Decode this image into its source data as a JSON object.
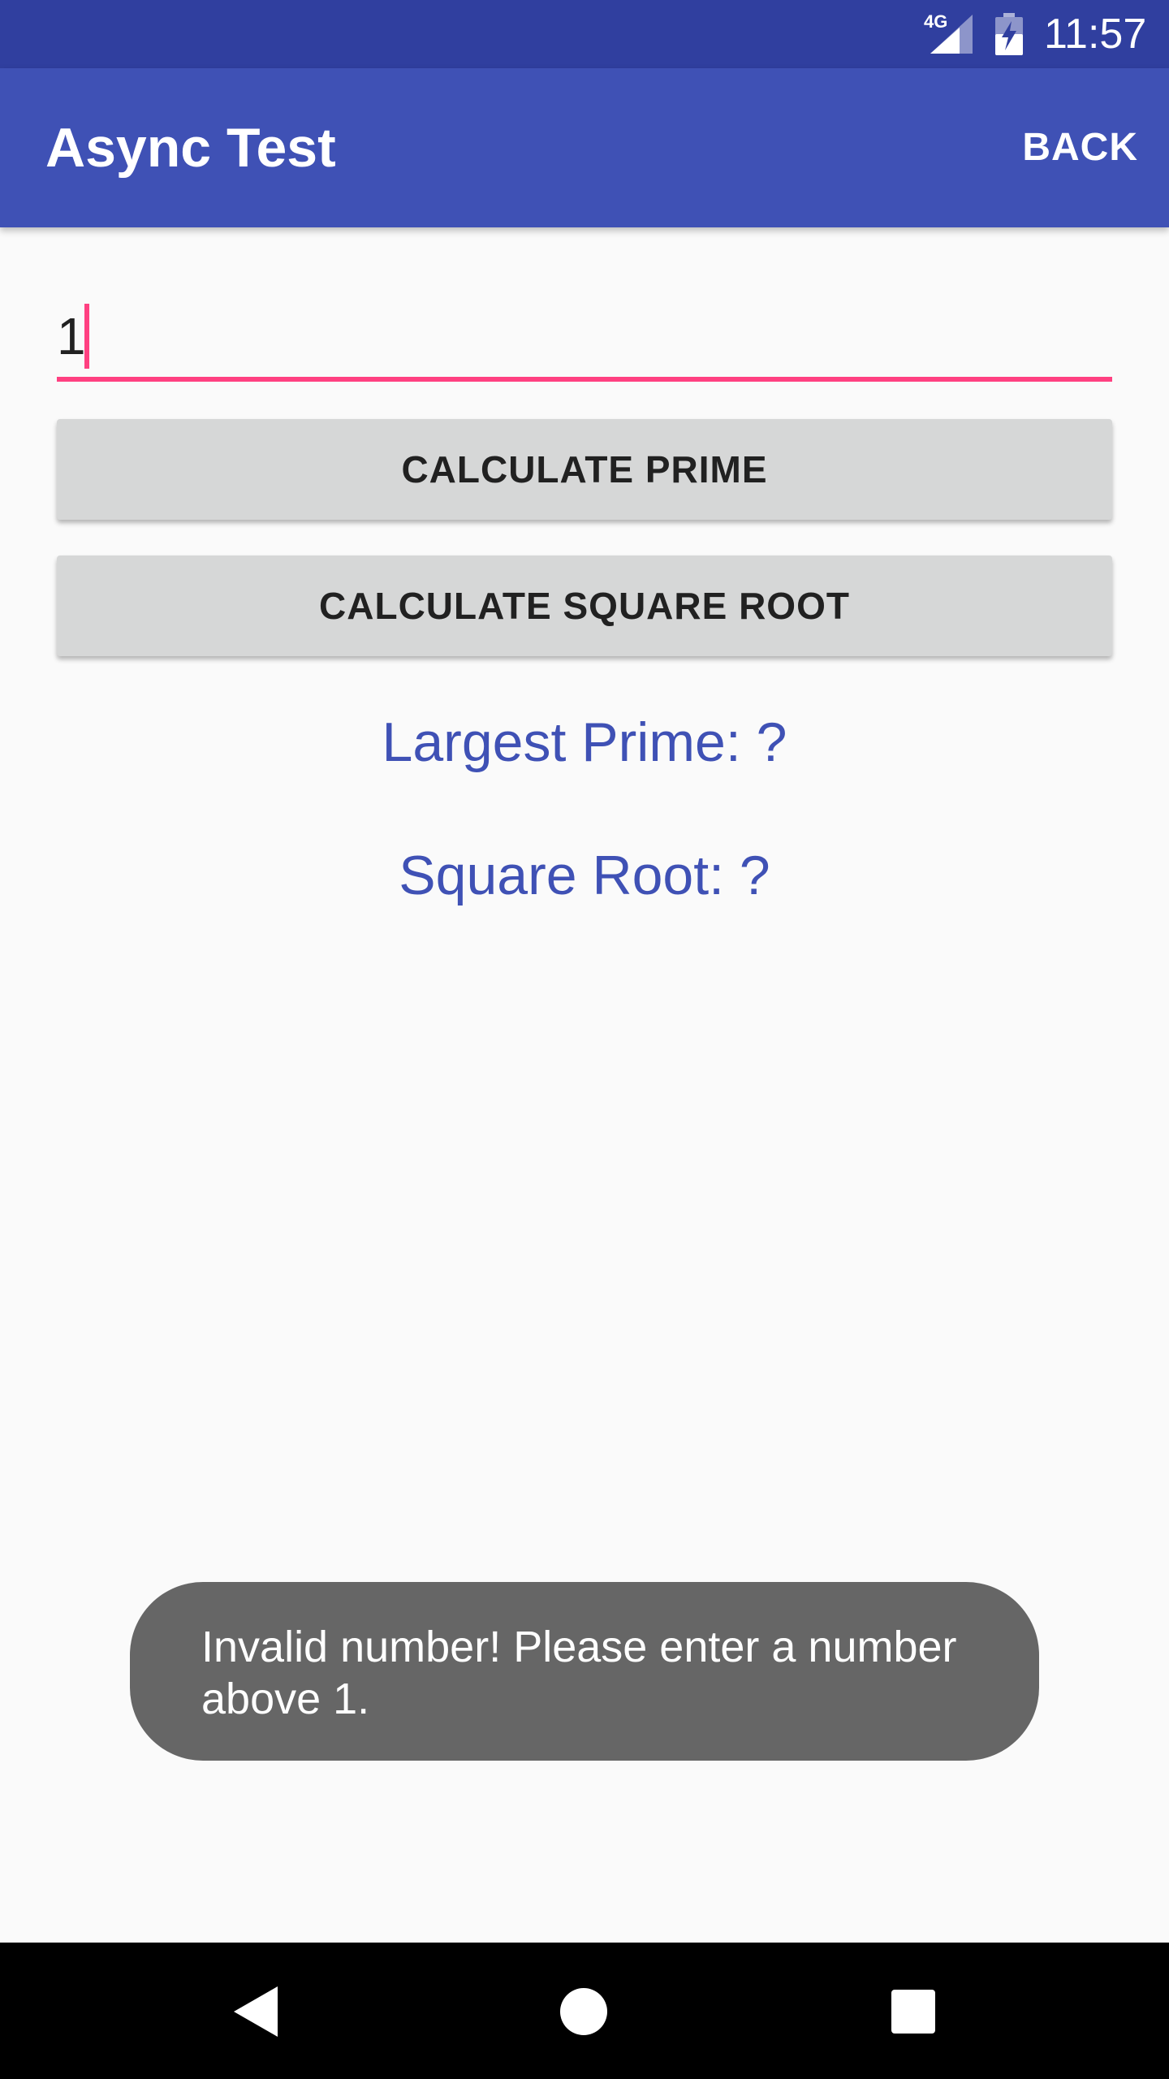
{
  "status_bar": {
    "network_label": "4G",
    "time": "11:57",
    "icons": [
      "signal-icon",
      "battery-icon"
    ]
  },
  "app_bar": {
    "title": "Async Test",
    "back_label": "BACK"
  },
  "input": {
    "value": "1"
  },
  "buttons": {
    "calculate_prime": "CALCULATE PRIME",
    "calculate_square_root": "CALCULATE SQUARE ROOT"
  },
  "results": {
    "largest_prime": "Largest Prime: ?",
    "square_root": "Square Root: ?"
  },
  "toast": {
    "message": "Invalid number! Please enter a number above 1."
  },
  "nav_bar": {
    "icons": [
      "back-triangle-icon",
      "home-circle-icon",
      "recents-square-icon"
    ]
  },
  "colors": {
    "status_bar": "#303f9f",
    "app_bar": "#3f51b5",
    "accent": "#ff4081",
    "result_text": "#3f51b5",
    "button_bg": "#d6d7d7",
    "toast_bg": "#666666"
  }
}
